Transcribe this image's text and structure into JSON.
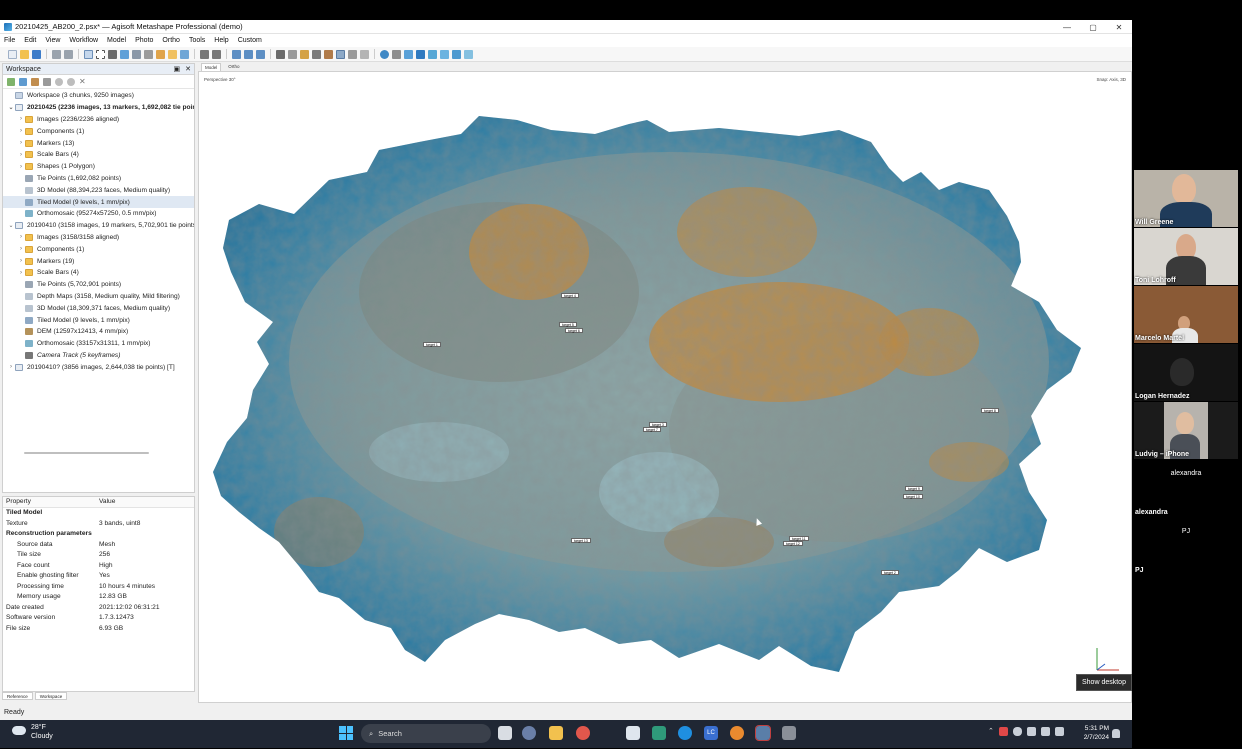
{
  "window": {
    "title": "20210425_AB200_2.psx* — Agisoft Metashape Professional (demo)",
    "controls": [
      "—",
      "▢",
      "✕"
    ]
  },
  "menu": [
    "File",
    "Edit",
    "View",
    "Workflow",
    "Model",
    "Photo",
    "Ortho",
    "Tools",
    "Help",
    "Custom"
  ],
  "workspace": {
    "title": "Workspace",
    "items": [
      {
        "label": "Workspace (3 chunks, 9250 images)",
        "icon": "root",
        "indent": 0,
        "exp": ""
      },
      {
        "label": "20210425 (2236 images, 13 markers, 1,692,082 tie points)",
        "icon": "chunk",
        "indent": 0,
        "exp": "⌄",
        "bold": true
      },
      {
        "label": "Images (2236/2236 aligned)",
        "icon": "folder",
        "indent": 1,
        "exp": "›"
      },
      {
        "label": "Components (1)",
        "icon": "folder",
        "indent": 1,
        "exp": "›"
      },
      {
        "label": "Markers (13)",
        "icon": "folder",
        "indent": 1,
        "exp": "›"
      },
      {
        "label": "Scale Bars (4)",
        "icon": "folder",
        "indent": 1,
        "exp": "›"
      },
      {
        "label": "Shapes (1 Polygon)",
        "icon": "folder",
        "indent": 1,
        "exp": "›"
      },
      {
        "label": "Tie Points (1,692,082 points)",
        "icon": "pts",
        "indent": 1,
        "exp": ""
      },
      {
        "label": "3D Model (88,394,223 faces, Medium quality)",
        "icon": "model",
        "indent": 1,
        "exp": ""
      },
      {
        "label": "Tiled Model (9 levels, 1 mm/pix)",
        "icon": "tiled",
        "indent": 1,
        "exp": "",
        "selected": true
      },
      {
        "label": "Orthomosaic (95274x57250, 0.5 mm/pix)",
        "icon": "ortho",
        "indent": 1,
        "exp": ""
      },
      {
        "label": "20190410 (3158 images, 19 markers, 5,702,901 tie points)",
        "icon": "chunk",
        "indent": 0,
        "exp": "⌄"
      },
      {
        "label": "Images (3158/3158 aligned)",
        "icon": "folder",
        "indent": 1,
        "exp": "›"
      },
      {
        "label": "Components (1)",
        "icon": "folder",
        "indent": 1,
        "exp": "›"
      },
      {
        "label": "Markers (19)",
        "icon": "folder",
        "indent": 1,
        "exp": "›"
      },
      {
        "label": "Scale Bars (4)",
        "icon": "folder",
        "indent": 1,
        "exp": "›"
      },
      {
        "label": "Tie Points (5,702,901 points)",
        "icon": "pts",
        "indent": 1,
        "exp": ""
      },
      {
        "label": "Depth Maps (3158, Medium quality, Mild filtering)",
        "icon": "model",
        "indent": 1,
        "exp": ""
      },
      {
        "label": "3D Model (18,309,371 faces, Medium quality)",
        "icon": "model",
        "indent": 1,
        "exp": ""
      },
      {
        "label": "Tiled Model (9 levels, 1 mm/pix)",
        "icon": "tiled",
        "indent": 1,
        "exp": ""
      },
      {
        "label": "DEM (12597x12413, 4 mm/pix)",
        "icon": "dem",
        "indent": 1,
        "exp": ""
      },
      {
        "label": "Orthomosaic (33157x31311, 1 mm/pix)",
        "icon": "ortho",
        "indent": 1,
        "exp": ""
      },
      {
        "label": "Camera Track (5 keyframes)",
        "icon": "cam",
        "indent": 1,
        "exp": "",
        "italic": true
      },
      {
        "label": "20190410? (3856 images, 2,644,038 tie points) [T]",
        "icon": "chunk",
        "indent": 0,
        "exp": "›"
      }
    ]
  },
  "properties": {
    "header": {
      "key": "Property",
      "value": "Value"
    },
    "rows": [
      {
        "k": "Tiled Model",
        "v": "",
        "bold": true,
        "indent": false
      },
      {
        "k": "Texture",
        "v": "3 bands, uint8",
        "indent": false
      },
      {
        "k": "Reconstruction parameters",
        "v": "",
        "bold": true,
        "indent": false
      },
      {
        "k": "Source data",
        "v": "Mesh",
        "indent": true
      },
      {
        "k": "Tile size",
        "v": "256",
        "indent": true
      },
      {
        "k": "Face count",
        "v": "High",
        "indent": true
      },
      {
        "k": "Enable ghosting filter",
        "v": "Yes",
        "indent": true
      },
      {
        "k": "Processing time",
        "v": "10 hours 4 minutes",
        "indent": true
      },
      {
        "k": "Memory usage",
        "v": "12.83 GB",
        "indent": true
      },
      {
        "k": "Date created",
        "v": "2021:12:02 06:31:21",
        "indent": false
      },
      {
        "k": "Software version",
        "v": "1.7.3.12473",
        "indent": false
      },
      {
        "k": "File size",
        "v": "6.93 GB",
        "indent": false
      }
    ],
    "tabs": [
      "Reference",
      "Workspace"
    ]
  },
  "status": "Ready",
  "view": {
    "tabs": [
      "Model",
      "Ortho"
    ],
    "perspective": "Perspective 30°",
    "snap": "Snap: Axis, 3D",
    "markers": [
      "target 4",
      "target 5",
      "target 6",
      "target 1",
      "target 3",
      "target 7",
      "target 8",
      "target 9",
      "target 10",
      "target 11",
      "target 12",
      "target 13",
      "target 2"
    ]
  },
  "tooltip": "Show desktop",
  "taskbar": {
    "weather_temp": "28°F",
    "weather_desc": "Cloudy",
    "search_label": "Search",
    "time": "5:31 PM",
    "date": "2/7/2024"
  },
  "participants": {
    "video": [
      {
        "name": "Will Greene"
      },
      {
        "name": "Toni Lohroff"
      },
      {
        "name": "Marcelo Martel"
      },
      {
        "name": "Logan Hernadez"
      },
      {
        "name": "Ludvig – iPhone"
      }
    ],
    "names": [
      {
        "center": "alexandra",
        "label": "alexandra"
      },
      {
        "center": "PJ",
        "label": "PJ"
      }
    ]
  },
  "colors": {
    "accent": "#0078d7",
    "selection": "#dfe8f3",
    "taskbar": "#202734"
  }
}
